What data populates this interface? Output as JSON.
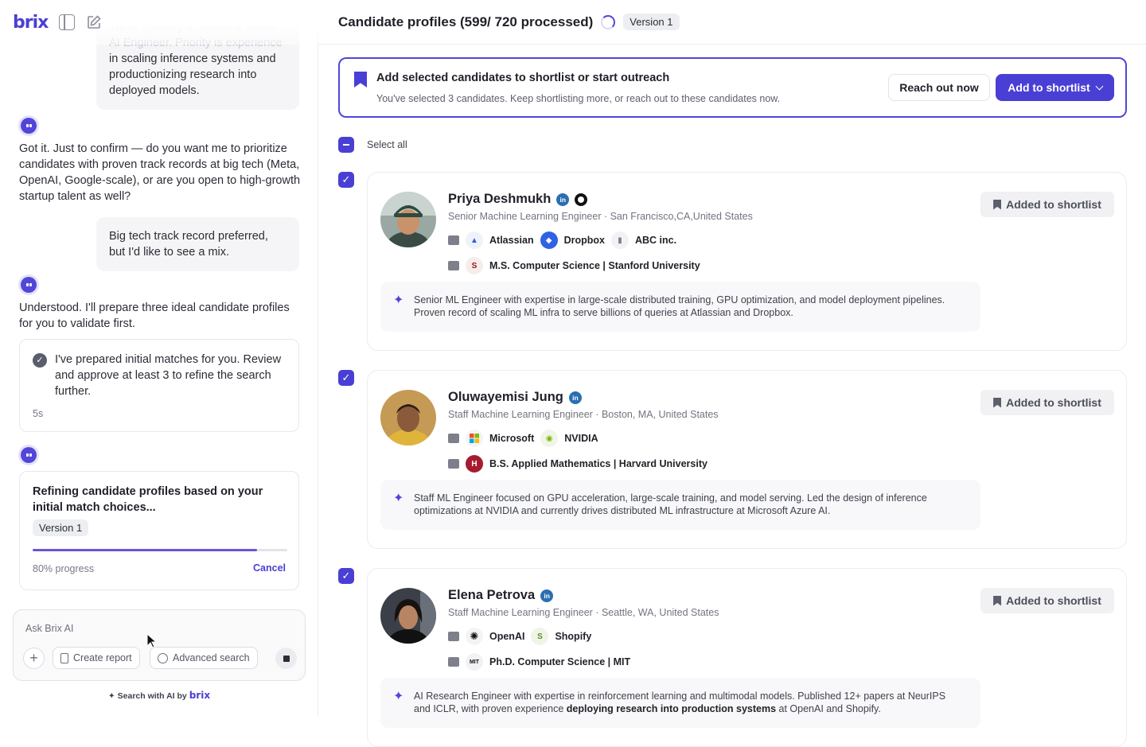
{
  "app": {
    "logo": "brix"
  },
  "chat": {
    "faded_text": "We're opening a role for a Senior AI Engineer. Priority is experience",
    "user_msg_1": "in scaling inference systems and productionizing research into deployed models.",
    "bot_msg_1": "Got it. Just to confirm — do you want me to prioritize candidates with proven track records at big tech (Meta, OpenAI, Google-scale), or are you open to high-growth startup talent as well?",
    "user_msg_2": "Big tech track record preferred, but I'd like to see a mix.",
    "bot_msg_2": "Understood. I'll prepare three ideal candidate profiles for you to validate first.",
    "status_card": {
      "text": "I've prepared initial matches for you. Review and approve at least 3 to refine the search further.",
      "time": "5s"
    },
    "refine_card": {
      "title": "Refining candidate profiles based on your initial match choices...",
      "version": "Version  1",
      "progress": 0.88,
      "progress_label": "80% progress",
      "cancel": "Cancel"
    },
    "input": {
      "placeholder": "Ask Brix AI",
      "create_report": "Create report",
      "advanced_search": "Advanced search"
    },
    "footer": {
      "text": "Search with AI by",
      "brand": "brix"
    }
  },
  "header": {
    "title": "Candidate profiles (599/ 720 processed)",
    "version": "Version  1"
  },
  "banner": {
    "title": "Add selected candidates to shortlist or start outreach",
    "subtitle": "You've selected 3 candidates. Keep shortlisting more, or reach out to these candidates now.",
    "reach_out": "Reach out now",
    "add_shortlist": "Add to shortlist"
  },
  "select_all": "Select all",
  "added_label": "Added to shortlist",
  "candidates": [
    {
      "name": "Priya Deshmukh",
      "title": "Senior Machine Learning Engineer · San Francisco,CA,United States",
      "companies": [
        "Atlassian",
        "Dropbox",
        "ABC inc."
      ],
      "education": "M.S. Computer Science | Stanford University",
      "summary_1": "Senior ML Engineer with expertise in large-scale distributed training, GPU optimization, and model deployment pipelines.",
      "summary_2": "Proven record of scaling ML infra to serve billions of queries at Atlassian and Dropbox."
    },
    {
      "name": "Oluwayemisi Jung",
      "title": "Staff Machine Learning Engineer · Boston, MA, United States",
      "companies": [
        "Microsoft",
        "NVIDIA"
      ],
      "education": "B.S. Applied Mathematics | Harvard University",
      "summary_1": "Staff ML Engineer focused on GPU acceleration, large-scale training, and model serving. Led the design of inference",
      "summary_2": "optimizations at NVIDIA and currently drives distributed ML infrastructure at Microsoft Azure AI."
    },
    {
      "name": "Elena Petrova",
      "title": "Staff Machine Learning Engineer · Seattle, WA, United States",
      "companies": [
        "OpenAI",
        "Shopify"
      ],
      "education": "Ph.D. Computer Science | MIT",
      "summary_1": "AI Research Engineer with expertise in reinforcement learning and multimodal models. Published 12+ papers at NeurIPS",
      "summary_2a": "and ICLR, with proven experience ",
      "summary_2b": "deploying research into production systems",
      "summary_2c": " at OpenAI and Shopify."
    }
  ]
}
